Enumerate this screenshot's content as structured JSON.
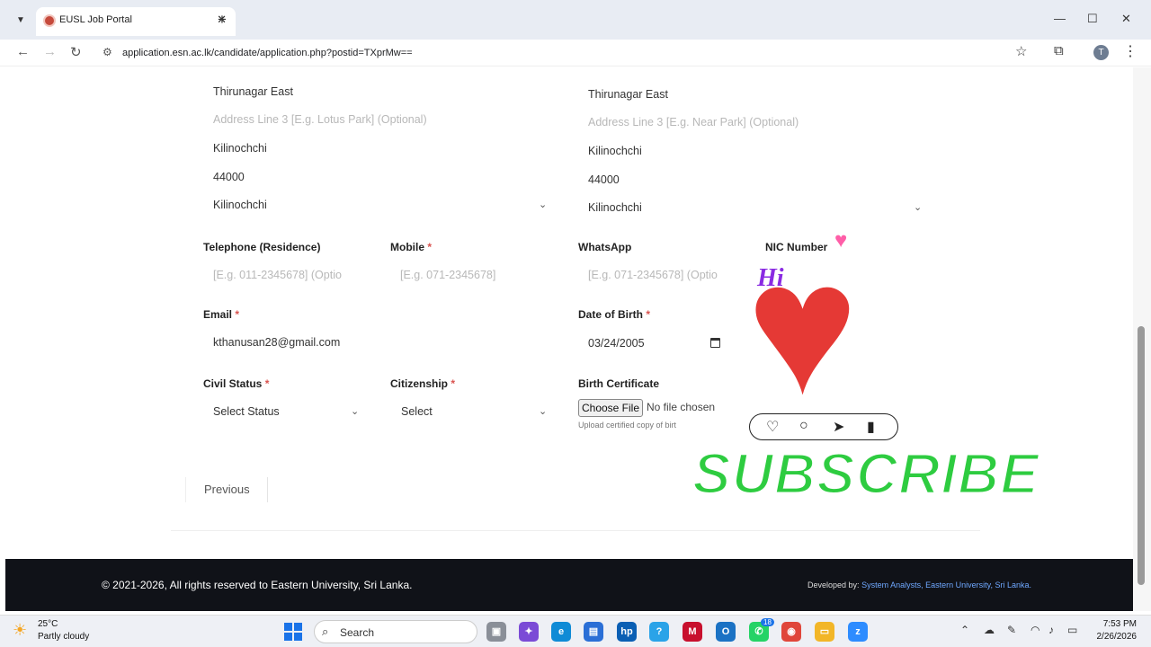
{
  "browser": {
    "tab_title": "EUSL Job Portal",
    "url": "application.esn.ac.lk/candidate/application.php?postid=TXprMw==",
    "avatar_letter": "T"
  },
  "form": {
    "permanent_address": {
      "line2": "Thirunagar East",
      "line3_placeholder": "Address Line 3 [E.g. Lotus Park]  (Optional)",
      "city": "Kilinochchi",
      "postal_code": "44000",
      "district": "Kilinochchi"
    },
    "postal_address": {
      "line2": "Thirunagar East",
      "line3_placeholder": "Address Line 3 [E.g. Near Park] (Optional)",
      "city": "Kilinochchi",
      "postal_code": "44000",
      "district": "Kilinochchi"
    },
    "telephone": {
      "label": "Telephone (Residence)",
      "placeholder": "[E.g. 011-2345678] (Optio"
    },
    "mobile": {
      "label": "Mobile",
      "required": "*",
      "placeholder": "[E.g. 071-2345678]"
    },
    "whatsapp": {
      "label": "WhatsApp",
      "placeholder": "[E.g. 071-2345678] (Optio"
    },
    "nic": {
      "label": "NIC Number"
    },
    "email": {
      "label": "Email",
      "required": "*",
      "value": "kthanusan28@gmail.com"
    },
    "dob": {
      "label": "Date of Birth",
      "required": "*",
      "value": "03/24/2005"
    },
    "civil_status": {
      "label": "Civil Status",
      "required": "*",
      "value": "Select Status"
    },
    "citizenship": {
      "label": "Citizenship",
      "required": "*",
      "value": "Select"
    },
    "birth_certificate": {
      "label": "Birth Certificate",
      "button": "Choose File",
      "status": "No file chosen",
      "help": "Upload certified copy of birt"
    },
    "previous_label": "Previous"
  },
  "overlay": {
    "hi_text": "Hi",
    "subscribe_text": "SUBSCRIBE"
  },
  "footer": {
    "copyright": "© 2021-2026, All rights reserved to Eastern University, Sri Lanka.",
    "developed_by_label": "Developed by:",
    "developed_by_link": "System Analysts, Eastern University, Sri Lanka."
  },
  "taskbar": {
    "temperature": "25°C",
    "condition": "Partly cloudy",
    "search_label": "Search",
    "time": "7:53 PM",
    "date": "2/26/2026",
    "whatsapp_badge": "18"
  }
}
